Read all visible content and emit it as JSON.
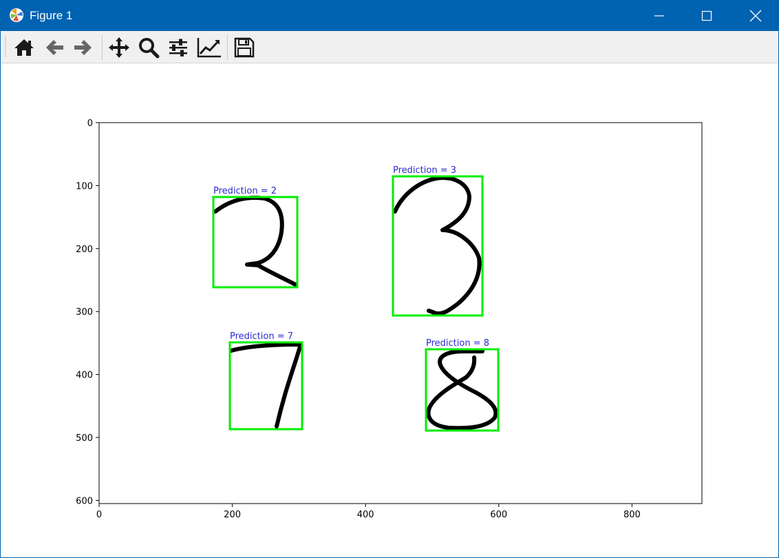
{
  "window": {
    "title": "Figure 1",
    "icon": "matplotlib-icon",
    "controls": [
      "minimize-icon",
      "maximize-icon",
      "close-icon"
    ]
  },
  "toolbar": {
    "buttons": [
      {
        "name": "home-button",
        "icon": "home-icon"
      },
      {
        "name": "back-button",
        "icon": "arrow-left-icon"
      },
      {
        "name": "forward-button",
        "icon": "arrow-right-icon"
      },
      {
        "name": "pan-button",
        "icon": "move-icon"
      },
      {
        "name": "zoom-button",
        "icon": "magnifier-icon"
      },
      {
        "name": "subplots-button",
        "icon": "sliders-icon"
      },
      {
        "name": "customize-button",
        "icon": "line-chart-icon"
      },
      {
        "name": "save-button",
        "icon": "floppy-disk-icon"
      }
    ]
  },
  "plot": {
    "x_ticks": [
      "0",
      "200",
      "400",
      "600",
      "800"
    ],
    "y_ticks": [
      "0",
      "100",
      "200",
      "300",
      "400",
      "500",
      "600"
    ],
    "xlim": [
      0,
      905
    ],
    "ylim": [
      605,
      0
    ],
    "box_color": "#00ee00",
    "label_color": "#2a2ad0",
    "detections": [
      {
        "label": "Prediction = 2",
        "digit": "2"
      },
      {
        "label": "Prediction = 3",
        "digit": "3"
      },
      {
        "label": "Prediction = 7",
        "digit": "7"
      },
      {
        "label": "Prediction = 8",
        "digit": "8"
      }
    ]
  }
}
